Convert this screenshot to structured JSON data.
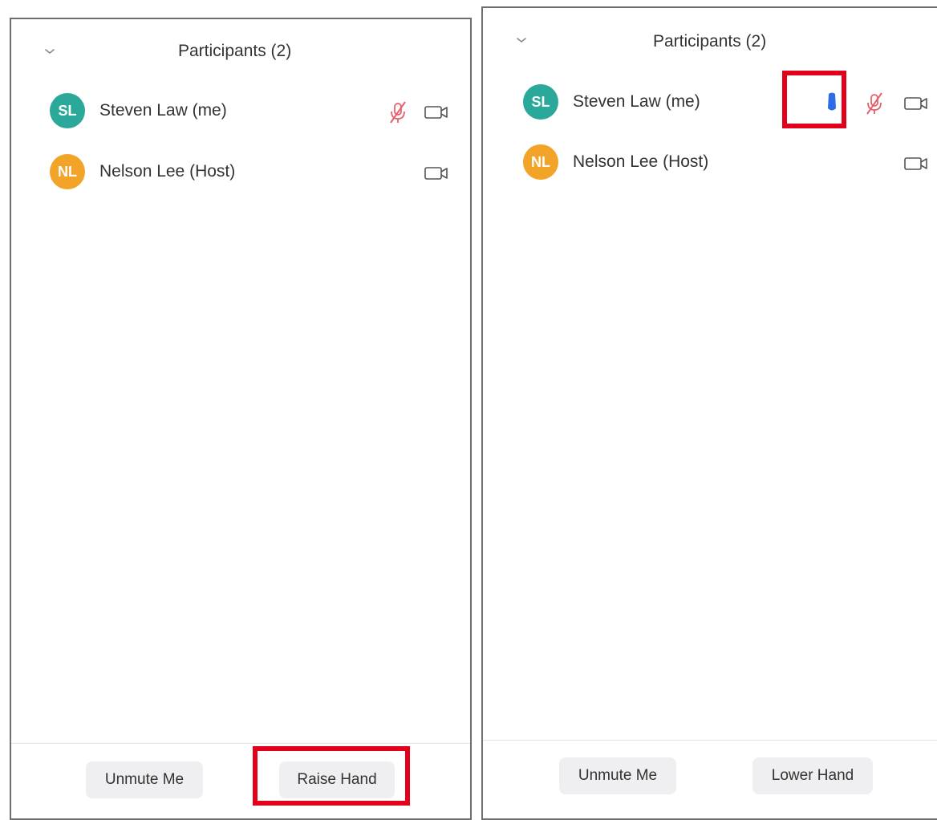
{
  "colors": {
    "panel_border": "#6e6e6e",
    "avatar_teal": "#2aa99a",
    "avatar_orange": "#f2a429",
    "muted_red": "#e8606b",
    "raised_hand_blue": "#2d6ee8",
    "highlight_red": "#e3001b"
  },
  "left_panel": {
    "title": "Participants (2)",
    "participants": [
      {
        "initials": "SL",
        "name": "Steven Law (me)",
        "avatar_color": "teal",
        "mic": "muted-mic-icon",
        "video": "video-camera-icon"
      },
      {
        "initials": "NL",
        "name": "Nelson Lee (Host)",
        "avatar_color": "orange",
        "video": "video-camera-icon"
      }
    ],
    "buttons": {
      "unmute": "Unmute Me",
      "raise_hand": "Raise Hand"
    }
  },
  "right_panel": {
    "title": "Participants (2)",
    "participants": [
      {
        "initials": "SL",
        "name": "Steven Law (me)",
        "avatar_color": "teal",
        "status": "raised-hand-icon",
        "mic": "muted-mic-icon",
        "video": "video-camera-icon"
      },
      {
        "initials": "NL",
        "name": "Nelson Lee (Host)",
        "avatar_color": "orange",
        "video": "video-camera-icon"
      }
    ],
    "buttons": {
      "unmute": "Unmute Me",
      "lower_hand": "Lower Hand"
    }
  }
}
